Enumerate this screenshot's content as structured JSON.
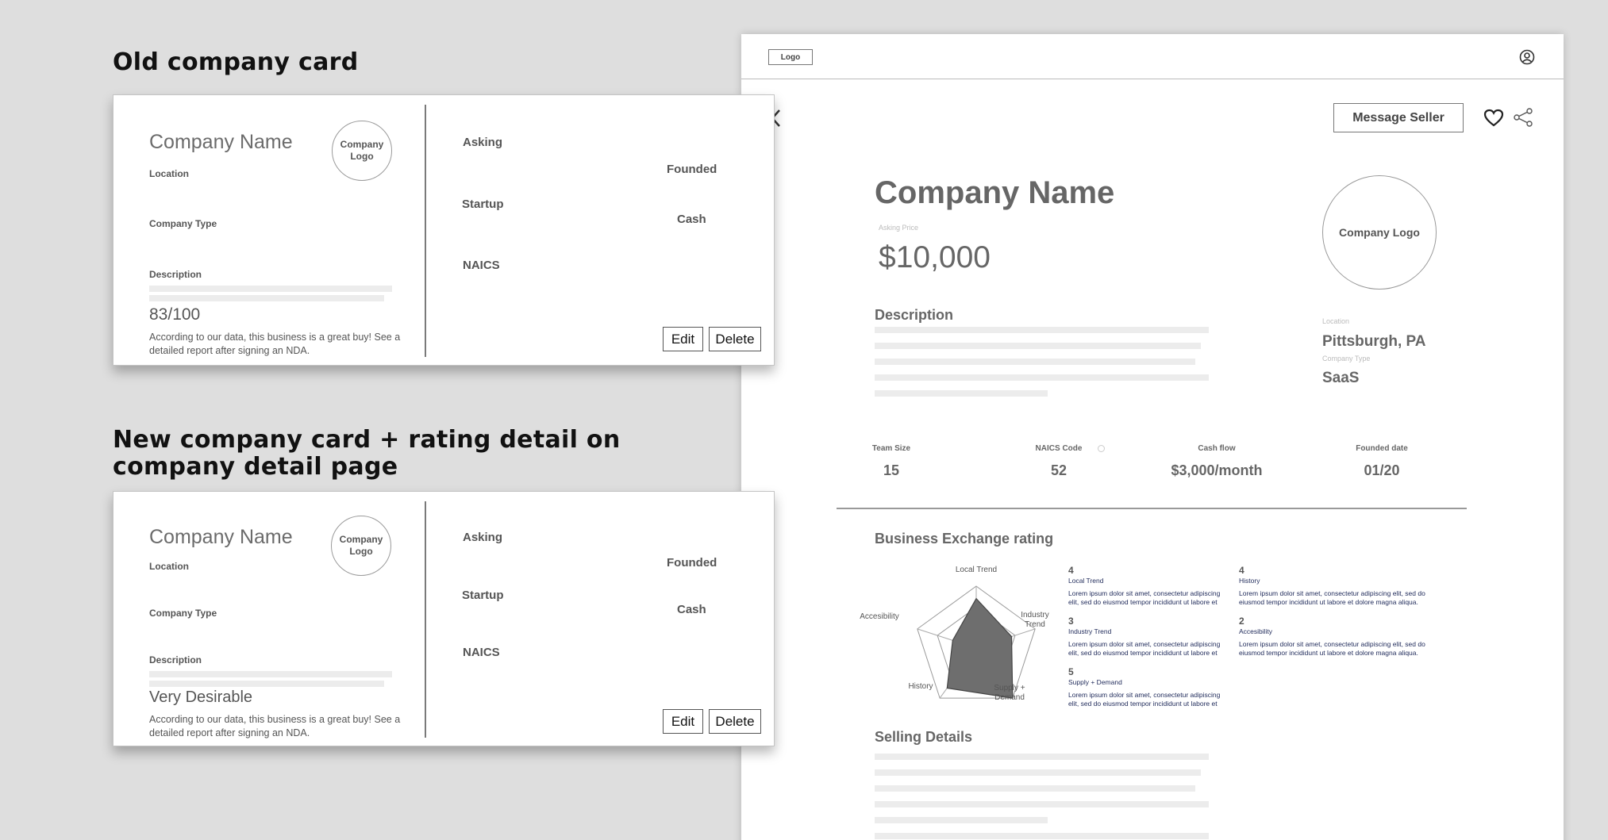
{
  "old_section": {
    "heading": "Old company card"
  },
  "new_section": {
    "heading_line1": "New company card + rating detail on",
    "heading_line2": "company detail page"
  },
  "old_card": {
    "company_name": "Company Name",
    "location_label": "Location",
    "company_type_label": "Company Type",
    "description_label": "Description",
    "logo_label": "Company Logo",
    "rating": "83/100",
    "rating_note": "According to our data, this business is a great buy! See a detailed report after signing an NDA.",
    "asking_label": "Asking",
    "founded_label": "Founded",
    "startup_label": "Startup",
    "cash_label": "Cash",
    "naics_label": "NAICS",
    "edit_label": "Edit",
    "delete_label": "Delete"
  },
  "new_card": {
    "company_name": "Company Name",
    "location_label": "Location",
    "company_type_label": "Company Type",
    "description_label": "Description",
    "logo_label": "Company Logo",
    "rating": "Very Desirable",
    "rating_note": "According to our data, this business is a great buy! See a detailed report after signing an NDA.",
    "asking_label": "Asking",
    "founded_label": "Founded",
    "startup_label": "Startup",
    "cash_label": "Cash",
    "naics_label": "NAICS",
    "edit_label": "Edit",
    "delete_label": "Delete"
  },
  "detail": {
    "logo_label": "Logo",
    "message_seller": "Message Seller",
    "company_name": "Company Name",
    "asking_price_label": "Asking Price",
    "asking_price": "$10,000",
    "description_title": "Description",
    "company_logo": "Company Logo",
    "location_label": "Location",
    "location": "Pittsburgh, PA",
    "company_type_label": "Company Type",
    "company_type": "SaaS",
    "stats": [
      {
        "label": "Team Size",
        "value": "15"
      },
      {
        "label": "NAICS Code",
        "value": "52"
      },
      {
        "label": "Cash flow",
        "value": "$3,000/month"
      },
      {
        "label": "Founded date",
        "value": "01/20"
      }
    ],
    "rating_title": "Business Exchange rating",
    "radar_axes": [
      "Local Trend",
      "Industry Trend",
      "Supply + Demand",
      "History",
      "Accesibility"
    ],
    "radar_values": [
      4,
      3,
      5,
      4,
      2
    ],
    "radar_max": 5,
    "ratings": [
      {
        "score": "4",
        "name": "Local Trend",
        "text": "Lorem ipsum dolor sit amet, consectetur adipiscing elit, sed do eiusmod tempor incididunt ut labore et"
      },
      {
        "score": "4",
        "name": "History",
        "text": "Lorem ipsum dolor sit amet, consectetur adipiscing elit, sed do eiusmod tempor incididunt ut labore et dolore magna aliqua."
      },
      {
        "score": "3",
        "name": "Industry Trend",
        "text": "Lorem ipsum dolor sit amet, consectetur adipiscing elit, sed do eiusmod tempor incididunt ut labore et"
      },
      {
        "score": "2",
        "name": "Accesibility",
        "text": "Lorem ipsum dolor sit amet, consectetur adipiscing elit, sed do eiusmod tempor incididunt ut labore et dolore magna aliqua."
      },
      {
        "score": "5",
        "name": "Supply + Demand",
        "text": "Lorem ipsum dolor sit amet, consectetur adipiscing elit, sed do eiusmod tempor incididunt ut labore et"
      }
    ],
    "selling_title": "Selling Details"
  }
}
